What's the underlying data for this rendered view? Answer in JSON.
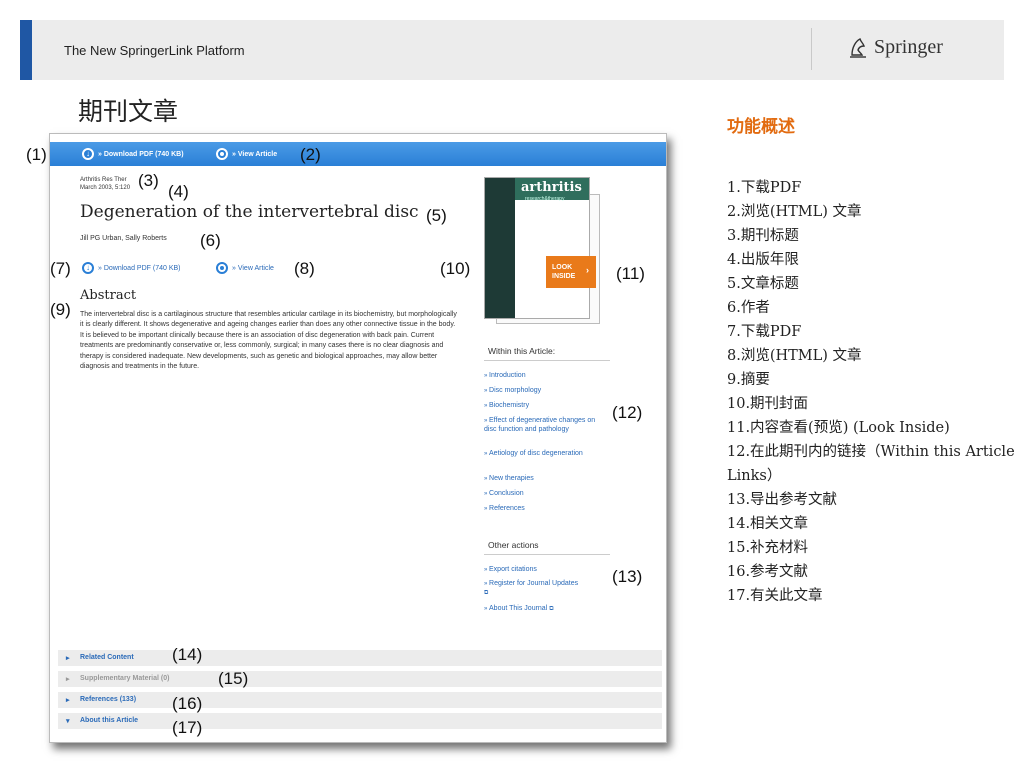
{
  "header": {
    "title": "The New SpringerLink Platform",
    "logo_text": "Springer"
  },
  "page_heading": "期刊文章",
  "screenshot": {
    "download_pdf": "» Download PDF (740 KB)",
    "view_article": "» View Article",
    "journal": "Arthritis Res Ther",
    "date": "March 2003, 5:120",
    "article_title": "Degeneration of the intervertebral disc",
    "authors": "Jill PG Urban, Sally Roberts",
    "abstract_heading": "Abstract",
    "abstract_text": "The intervertebral disc is a cartilaginous structure that resembles articular cartilage in its biochemistry, but morphologically it is clearly different. It shows degenerative and ageing changes earlier than does any other connective tissue in the body. It is believed to be important clinically because there is an association of disc degeneration with back pain. Current treatments are predominantly conservative or, less commonly, surgical; in many cases there is no clear diagnosis and therapy is considered inadequate. New developments, such as genetic and biological approaches, may allow better diagnosis and treatments in the future.",
    "cover_word": "arthritis",
    "cover_subword": "research&therapy",
    "look_inside": "LOOK INSIDE",
    "within_heading": "Within this Article:",
    "within_links": [
      "Introduction",
      "Disc morphology",
      "Biochemistry",
      "Effect of degenerative changes on disc function and pathology",
      "Aetiology of disc degeneration",
      "New therapies",
      "Conclusion",
      "References"
    ],
    "other_heading": "Other actions",
    "other_links": [
      "Export citations",
      "Register for Journal Updates",
      "About This Journal"
    ],
    "accordions": [
      "Related Content",
      "Supplementary Material (0)",
      "References (133)",
      "About this Article"
    ]
  },
  "callouts": [
    "(1)",
    "(2)",
    "(3)",
    "(4)",
    "(5)",
    "(6)",
    "(7)",
    "(8)",
    "(9)",
    "(10)",
    "(11)",
    "(12)",
    "(13)",
    "(14)",
    "(15)",
    "(16)",
    "(17)"
  ],
  "features": {
    "heading": "功能概述",
    "items": [
      "1.下载PDF",
      "2.浏览(HTML) 文章",
      "3.期刊标题",
      "4.出版年限",
      "5.文章标题",
      "6.作者",
      "7.下载PDF",
      "8.浏览(HTML) 文章",
      "9.摘要",
      "10.期刊封面",
      "11.内容查看(预览) (Look Inside)",
      "12.在此期刊内的链接（Within this Article Links）",
      "13.导出参考文献",
      "14.相关文章",
      "15.补充材料",
      "16.参考文献",
      "17.有关此文章"
    ]
  },
  "colors": {
    "accent_blue": "#1f57a4",
    "bar_blue": "#2a7fd6",
    "link_blue": "#2a6ab8",
    "feature_orange": "#e26b10",
    "look_inside_orange": "#e97a1a"
  }
}
